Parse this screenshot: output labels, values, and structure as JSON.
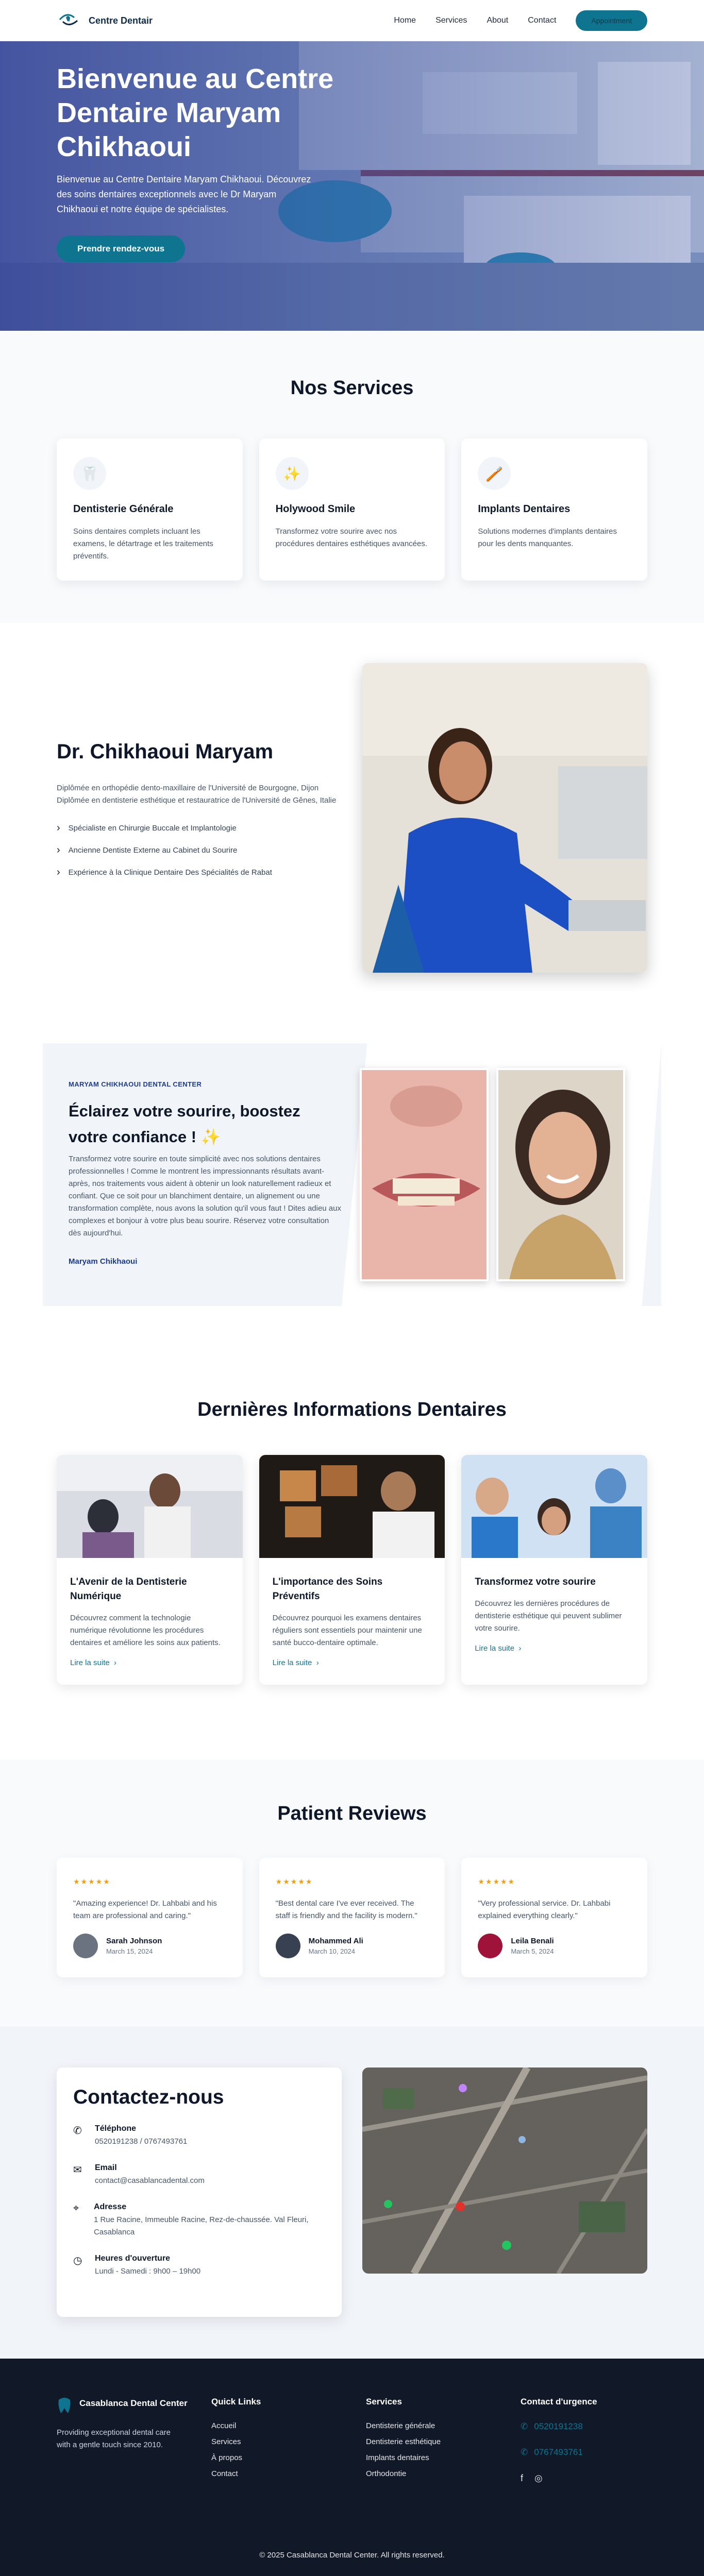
{
  "header": {
    "logo_text": "Centre Dentair",
    "nav": [
      "Home",
      "Services",
      "About",
      "Contact"
    ],
    "cta": "Appointment"
  },
  "hero": {
    "title": "Bienvenue au Centre Dentaire Maryam Chikhaoui",
    "subtitle": "Bienvenue au Centre Dentaire Maryam Chikhaoui. Découvrez des soins dentaires exceptionnels avec le Dr Maryam Chikhaoui et notre équipe de spécialistes.",
    "button": "Prendre rendez-vous"
  },
  "services": {
    "title": "Nos Services",
    "items": [
      {
        "icon": "tooth-icon",
        "glyph": "🦷",
        "title": "Dentisterie Générale",
        "text": "Soins dentaires complets incluant les examens, le détartrage et les traitements préventifs."
      },
      {
        "icon": "sparkle-icon",
        "glyph": "✨",
        "title": "Holywood Smile",
        "text": "Transformez votre sourire avec nos procédures dentaires esthétiques avancées."
      },
      {
        "icon": "implant-icon",
        "glyph": "🪥",
        "title": "Implants Dentaires",
        "text": "Solutions modernes d'implants dentaires pour les dents manquantes."
      }
    ]
  },
  "doctor": {
    "name": "Dr. Chikhaoui Maryam",
    "description": "Diplômée en orthopédie dento-maxillaire de l'Université de Bourgogne, Dijon Diplômée en dentisterie esthétique et restauratrice de l'Université de Gênes, Italie",
    "highlights": [
      "Spécialiste en Chirurgie Buccale et Implantologie",
      "Ancienne Dentiste Externe au Cabinet du Sourire",
      "Expérience à la Clinique Dentaire Des Spécialités de Rabat"
    ]
  },
  "promo": {
    "kicker": "MARYAM CHIKHAOUI DENTAL CENTER",
    "title": "Éclairez votre sourire, boostez votre confiance ! ✨",
    "text": "Transformez votre sourire en toute simplicité avec nos solutions dentaires professionnelles ! Comme le montrent les impressionnants résultats avant-après, nos traitements vous aident à obtenir un look naturellement radieux et confiant. Que ce soit pour un blanchiment dentaire, un alignement ou une transformation complète, nous avons la solution qu'il vous faut ! Dites adieu aux complexes et bonjour à votre plus beau sourire. Réservez votre consultation dès aujourd'hui.",
    "signature": "Maryam Chikhaoui"
  },
  "blog": {
    "title": "Dernières Informations Dentaires",
    "read_more": "Lire la suite",
    "posts": [
      {
        "title": "L'Avenir de la Dentisterie Numérique",
        "text": "Découvrez comment la technologie numérique révolutionne les procédures dentaires et améliore les soins aux patients."
      },
      {
        "title": "L'importance des Soins Préventifs",
        "text": "Découvrez pourquoi les examens dentaires réguliers sont essentiels pour maintenir une santé bucco-dentaire optimale."
      },
      {
        "title": "Transformez votre sourire",
        "text": "Découvrez les dernières procédures de dentisterie esthétique qui peuvent sublimer votre sourire."
      }
    ]
  },
  "reviews": {
    "title": "Patient Reviews",
    "stars": "★★★★★",
    "items": [
      {
        "quote": "\"Amazing experience! Dr. Lahbabi and his team are professional and caring.\"",
        "name": "Sarah Johnson",
        "date": "March 15, 2024",
        "avatar_color": "#6b7280"
      },
      {
        "quote": "\"Best dental care I've ever received. The staff is friendly and the facility is modern.\"",
        "name": "Mohammed Ali",
        "date": "March 10, 2024",
        "avatar_color": "#374151"
      },
      {
        "quote": "\"Very professional service. Dr. Lahbabi explained everything clearly.\"",
        "name": "Leila Benali",
        "date": "March 5, 2024",
        "avatar_color": "#9f1239"
      }
    ]
  },
  "contact": {
    "title": "Contactez-nous",
    "items": [
      {
        "icon": "phone-icon",
        "glyph": "✆",
        "label": "Téléphone",
        "value": "0520191238 / 0767493761"
      },
      {
        "icon": "mail-icon",
        "glyph": "✉",
        "label": "Email",
        "value": "contact@casablancadental.com"
      },
      {
        "icon": "location-icon",
        "glyph": "⌖",
        "label": "Adresse",
        "value": "1 Rue Racine, Immeuble Racine, Rez-de-chaussée. Val Fleuri, Casablanca"
      },
      {
        "icon": "clock-icon",
        "glyph": "◷",
        "label": "Heures d'ouverture",
        "value": "Lundi - Samedi : 9h00 – 19h00"
      }
    ]
  },
  "footer": {
    "brand": "Casablanca Dental Center",
    "tagline": "Providing exceptional dental care with a gentle touch since 2010.",
    "quick_title": "Quick Links",
    "quick_links": [
      "Accueil",
      "Services",
      "À propos",
      "Contact"
    ],
    "services_title": "Services",
    "services_links": [
      "Dentisterie générale",
      "Dentisterie esthétique",
      "Implants dentaires",
      "Orthodontie"
    ],
    "urgent_title": "Contact d'urgence",
    "phones": [
      "0520191238",
      "0767493761"
    ],
    "copyright": "© 2025 Casablanca Dental Center. All rights reserved."
  },
  "colors": {
    "primary": "#0e7490",
    "navy": "#111827",
    "hero_overlay": "#313f96"
  }
}
